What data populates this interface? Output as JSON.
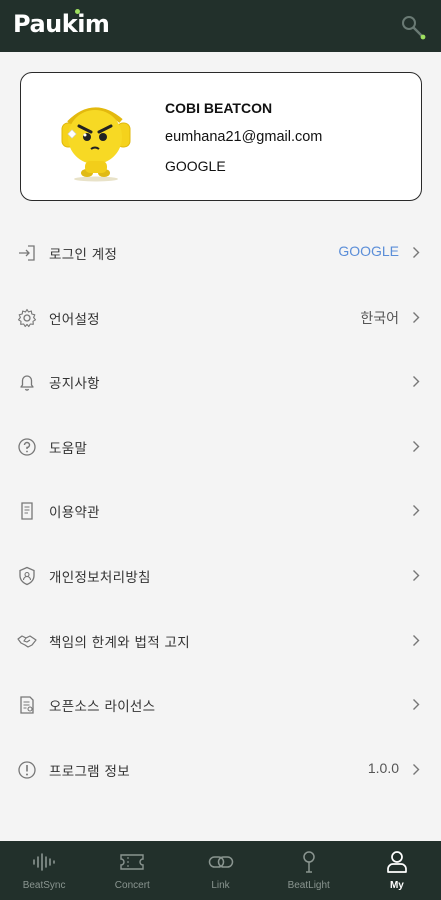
{
  "app": {
    "logo_text": "Paukim"
  },
  "colors": {
    "header_bg": "#22302b",
    "accent_blue": "#5b8ed8",
    "logo_dot": "#9fe060",
    "avatar_yellow": "#f5d21c"
  },
  "profile": {
    "name": "COBI BEATCON",
    "email": "eumhana21@gmail.com",
    "provider": "GOOGLE"
  },
  "menu": [
    {
      "icon": "login-icon",
      "label": "로그인 계정",
      "value": "GOOGLE"
    },
    {
      "icon": "gear-icon",
      "label": "언어설정",
      "value": "한국어"
    },
    {
      "icon": "bell-icon",
      "label": "공지사항",
      "value": ""
    },
    {
      "icon": "question-icon",
      "label": "도움말",
      "value": ""
    },
    {
      "icon": "document-icon",
      "label": "이용약관",
      "value": ""
    },
    {
      "icon": "shield-user-icon",
      "label": "개인정보처리방침",
      "value": ""
    },
    {
      "icon": "handshake-icon",
      "label": "책임의 한계와 법적 고지",
      "value": ""
    },
    {
      "icon": "license-icon",
      "label": "오픈소스 라이선스",
      "value": ""
    },
    {
      "icon": "info-icon",
      "label": "프로그램 정보",
      "value": "1.0.0"
    }
  ],
  "nav": [
    {
      "icon": "beatsync-icon",
      "label": "BeatSync",
      "active": false
    },
    {
      "icon": "ticket-icon",
      "label": "Concert",
      "active": false
    },
    {
      "icon": "link-icon",
      "label": "Link",
      "active": false
    },
    {
      "icon": "beatlight-icon",
      "label": "BeatLight",
      "active": false
    },
    {
      "icon": "person-icon",
      "label": "My",
      "active": true
    }
  ]
}
